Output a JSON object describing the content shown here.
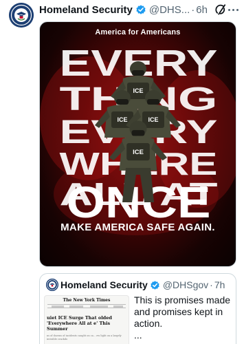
{
  "post": {
    "display_name": "Homeland Security",
    "handle": "@DHS...",
    "separator": "·",
    "timestamp": "6h"
  },
  "poster": {
    "kicker": "America for Americans",
    "headline_words": [
      "EVERY",
      "THING",
      "EVERY",
      "WHERE",
      "ALL AT",
      "ONCE"
    ],
    "officer_badge": "ICE",
    "footer": "MAKE AMERICA SAFE AGAIN."
  },
  "quoted_post": {
    "display_name": "Homeland Security",
    "handle": "@DHSgov",
    "separator": "·",
    "timestamp": "7h",
    "text": "This is promises made and promises kept in action.",
    "ellipsis": "...",
    "thumbnail": {
      "masthead": "The New York Times",
      "headline": "uiet ICE Surge That olded 'Everywhere All at e' This Summer",
      "body": "ns of dozens of incidents caught on ca... ew light on a largely invisible crackdo"
    }
  },
  "colors": {
    "brand_navy": "#1d3f73",
    "verified_blue": "#1d9bf0",
    "poster_red": "#8a1010",
    "muted_text": "#536471"
  },
  "icons": {
    "avatar": "dhs-seal-icon",
    "verified": "verified-badge-icon",
    "grok": "grok-icon",
    "more": "more-dots-icon"
  }
}
